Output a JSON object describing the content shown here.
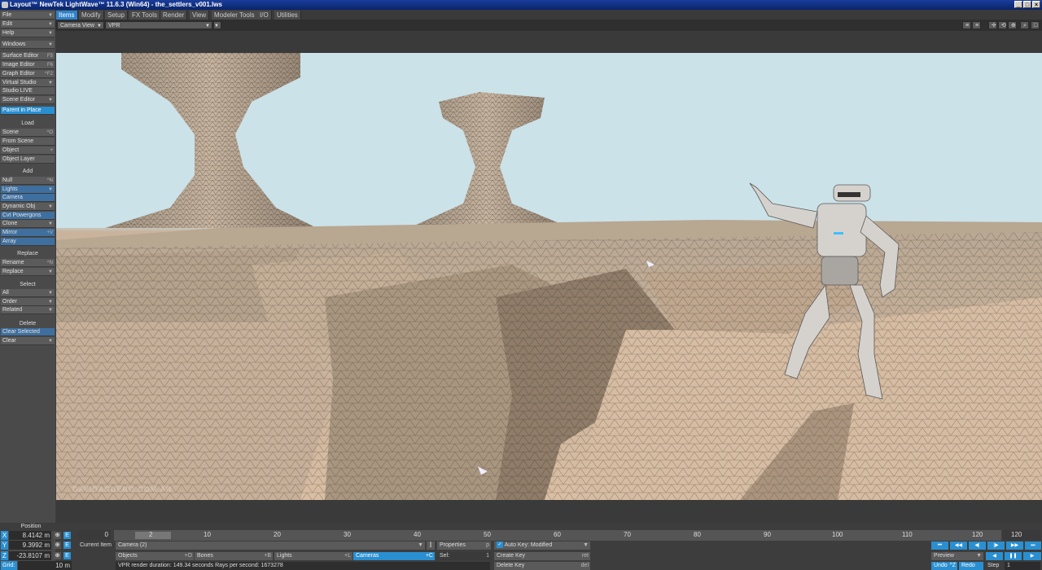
{
  "window": {
    "title": "Layout™ NewTek LightWave™ 11.6.3 (Win64) - the_settlers_v001.lws"
  },
  "tabs": [
    "Items",
    "Modify",
    "Setup",
    "FX Tools",
    "Render",
    "View",
    "Modeler Tools",
    "I/O",
    "Utilities"
  ],
  "viewport": {
    "view_mode": "Camera View",
    "render_mode": "VPR",
    "watermark": "DAVIDAGUERO.COM.AR"
  },
  "sidebar": {
    "top": [
      {
        "label": "File",
        "arrow": true
      },
      {
        "label": "Edit",
        "arrow": true
      },
      {
        "label": "Help",
        "arrow": true
      }
    ],
    "windows": [
      {
        "label": "Windows",
        "arrow": true
      },
      {
        "label": "Surface Editor",
        "sc": "F5"
      },
      {
        "label": "Image Editor",
        "sc": "F6"
      },
      {
        "label": "Graph Editor",
        "sc": "^F2"
      },
      {
        "label": "Virtual Studio",
        "arrow": true
      },
      {
        "label": "Studio LIVE"
      },
      {
        "label": "Scene Editor",
        "arrow": true
      }
    ],
    "parent_in_place": "Parent in Place",
    "load_head": "Load",
    "load": [
      {
        "label": "Scene",
        "sc": "^O"
      },
      {
        "label": "From Scene"
      },
      {
        "label": "Object",
        "sc": "+"
      },
      {
        "label": "Object Layer"
      }
    ],
    "add_head": "Add",
    "add": [
      {
        "label": "Null",
        "sc": "^N"
      },
      {
        "label": "Lights",
        "arrow": true
      },
      {
        "label": "Camera"
      },
      {
        "label": "Dynamic Obj",
        "arrow": true
      },
      {
        "label": "Cvt Powergons"
      },
      {
        "label": "Clone",
        "arrow": true
      },
      {
        "label": "Mirror",
        "sc": "+V"
      },
      {
        "label": "Array"
      }
    ],
    "replace_head": "Replace",
    "replace": [
      {
        "label": "Rename",
        "sc": "^N"
      },
      {
        "label": "Replace",
        "arrow": true
      }
    ],
    "select_head": "Select",
    "select": [
      {
        "label": "All",
        "arrow": true
      },
      {
        "label": "Order",
        "arrow": true
      },
      {
        "label": "Related",
        "arrow": true
      }
    ],
    "delete_head": "Delete",
    "delete": [
      {
        "label": "Clear Selected"
      },
      {
        "label": "Clear",
        "arrow": true
      }
    ]
  },
  "position": {
    "label": "Position",
    "x": "8.4142 m",
    "y": "9.3992 m",
    "z": "-23.8107 m",
    "grid_label": "Grid:",
    "grid": "10 m"
  },
  "timeline": {
    "start": "0",
    "end": "120",
    "ticks": [
      "2",
      "10",
      "20",
      "30",
      "40",
      "50",
      "60",
      "70",
      "80",
      "90",
      "100",
      "110",
      "120"
    ]
  },
  "current_item": {
    "label": "Current Item",
    "value": "Camera (2)"
  },
  "item_buttons": {
    "objects": "Objects",
    "objects_sc": "+O",
    "bones": "Bones",
    "bones_sc": "+B",
    "lights": "Lights",
    "lights_sc": "+L",
    "cameras": "Cameras",
    "cameras_sc": "+C"
  },
  "properties": {
    "label": "Properties",
    "sc": "p",
    "sel_label": "Sel:",
    "sel_value": "1"
  },
  "autokey": {
    "label": "Auto Key: Modified"
  },
  "keys": {
    "create": "Create Key",
    "create_sc": "ret",
    "delete": "Delete Key",
    "delete_sc": "del"
  },
  "status": "VPR render duration: 149.34 seconds  Rays per second: 1673278",
  "playback": {
    "preview": "Preview",
    "undo": "Undo",
    "undo_sc": "^Z",
    "redo": "Redo",
    "step_label": "Step",
    "step": "1"
  },
  "colors": {
    "accent": "#2a8fd0",
    "sky": "#cde3ea",
    "ground": "#c9ab8d"
  }
}
